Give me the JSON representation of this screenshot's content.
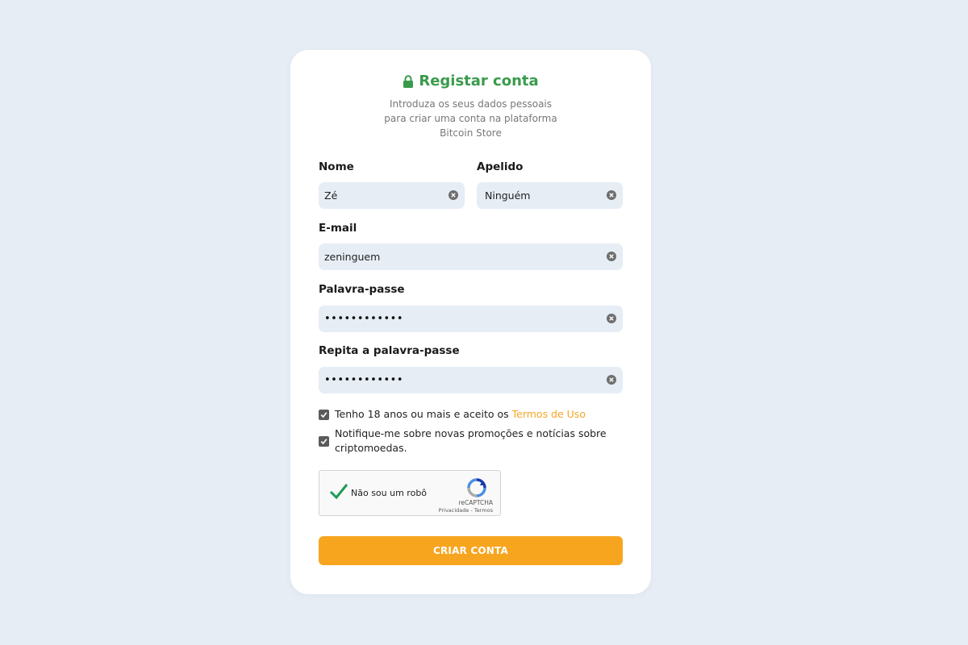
{
  "card": {
    "title": "Registar conta",
    "title_icon": "lock-icon",
    "subtitle_lines": [
      "Introduza os seus dados pessoais",
      "para criar uma conta na plataforma",
      "Bitcoin Store"
    ]
  },
  "form": {
    "first_name": {
      "label": "Nome",
      "value": "Zé"
    },
    "last_name": {
      "label": "Apelido",
      "value": "Ninguém"
    },
    "email": {
      "label": "E-mail",
      "value": "zeninguem"
    },
    "password": {
      "label": "Palavra-passe",
      "masked_value": "••••••••••••"
    },
    "password_confirm": {
      "label": "Repita a palavra-passe",
      "masked_value": "••••••••••••"
    },
    "terms": {
      "text": "Tenho 18 anos ou mais e aceito os ",
      "link": "Termos de Uso",
      "checked": true
    },
    "newsletter": {
      "line1": "Notifique-me sobre novas promoções e notícias sobre",
      "line2": "criptomoedas.",
      "checked": true
    },
    "captcha": {
      "label": "Não sou um robô",
      "brand": "reCAPTCHA",
      "links": "Privacidade - Termos",
      "checked": true
    },
    "submit_label": "CRIAR CONTA"
  },
  "colors": {
    "background": "#e6edf5",
    "title": "#3a9a4c",
    "accent": "#f7a51f",
    "link": "#f5a623"
  }
}
